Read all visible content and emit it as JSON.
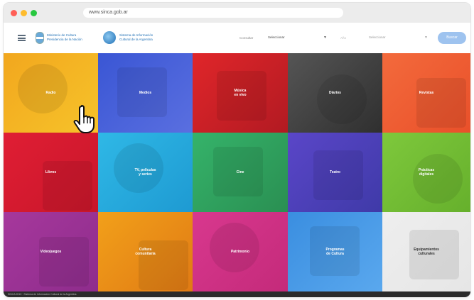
{
  "browser": {
    "url": "www.sinca.gob.ar"
  },
  "header": {
    "ministry": "Ministerio de Cultura\nPresidencia de la Nación",
    "agency": "Sistema de Información\nCultural de la Argentina",
    "filter1_label": "Consultar",
    "filter1_value": "Seleccionar",
    "filter2_label": "Año",
    "filter2_value": "Seleccionar",
    "search_label": "Buscar"
  },
  "tiles": [
    {
      "label": "Radio",
      "color": "#f2a71e",
      "color2": "#f6c32a"
    },
    {
      "label": "Medios",
      "color": "#3a56d4",
      "color2": "#5a6fe0"
    },
    {
      "label": "Música\nen vivo",
      "color": "#e0262a",
      "color2": "#b21a22"
    },
    {
      "label": "Diarios",
      "color": "#555555",
      "color2": "#2f2f2f"
    },
    {
      "label": "Revistas",
      "color": "#f36a3c",
      "color2": "#e9502a"
    },
    {
      "label": "Libros",
      "color": "#e01e34",
      "color2": "#c8162a"
    },
    {
      "label": "TV, películas\ny series",
      "color": "#2fb8e6",
      "color2": "#1e9ad2"
    },
    {
      "label": "Cine",
      "color": "#35b36a",
      "color2": "#2a8f52"
    },
    {
      "label": "Teatro",
      "color": "#5a46c8",
      "color2": "#3f3aa8"
    },
    {
      "label": "Prácticas\ndigitales",
      "color": "#7ec83c",
      "color2": "#66b02c"
    },
    {
      "label": "Videojuegos",
      "color": "#a6389c",
      "color2": "#8e2c8c"
    },
    {
      "label": "Cultura\ncomunitaria",
      "color": "#f2a01a",
      "color2": "#e07a14"
    },
    {
      "label": "Patrimonio",
      "color": "#d8388e",
      "color2": "#c42a7a"
    },
    {
      "label": "Programas\nde Cultura",
      "color": "#3a8ee0",
      "color2": "#5aa8ee"
    },
    {
      "label": "Equipamientos\nculturales",
      "color": "#eeeeee",
      "color2": "#e6e6e6",
      "dark": true
    }
  ],
  "footer": {
    "text": "SINCA 2019 · Sistema de Información Cultural de la Argentina"
  },
  "icons": {
    "cursor": "hand-pointer-icon",
    "menu": "hamburger-icon"
  }
}
